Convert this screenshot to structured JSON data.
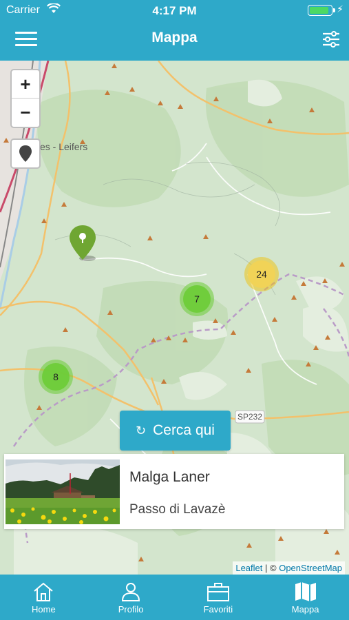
{
  "status_bar": {
    "carrier": "Carrier",
    "time": "4:17 PM",
    "battery_level": 0.9
  },
  "header": {
    "title": "Mappa",
    "menu_icon": "hamburger-icon",
    "filter_icon": "sliders-icon"
  },
  "map": {
    "zoom_in_label": "+",
    "zoom_out_label": "−",
    "place_label": "es - Leifers",
    "road_label": "SP232",
    "clusters": [
      {
        "count": "24",
        "color": "#f1d357"
      },
      {
        "count": "7",
        "color": "#6ecc39"
      },
      {
        "count": "8",
        "color": "#6ecc39"
      }
    ],
    "search_button": {
      "label": "Cerca qui",
      "icon": "refresh-icon"
    },
    "attribution": {
      "leaflet": "Leaflet",
      "separator": "| ©",
      "osm": "OpenStreetMap"
    }
  },
  "card": {
    "name": "Malga Laner",
    "location": "Passo di Lavazè"
  },
  "tabs": [
    {
      "label": "Home",
      "icon": "home-icon"
    },
    {
      "label": "Profilo",
      "icon": "user-icon"
    },
    {
      "label": "Favoriti",
      "icon": "briefcase-icon"
    },
    {
      "label": "Mappa",
      "icon": "map-icon"
    }
  ],
  "colors": {
    "accent": "#2ea9c9",
    "peak": "#c57a3a",
    "trail": "#b99bc7",
    "road": "#f3c16b"
  }
}
